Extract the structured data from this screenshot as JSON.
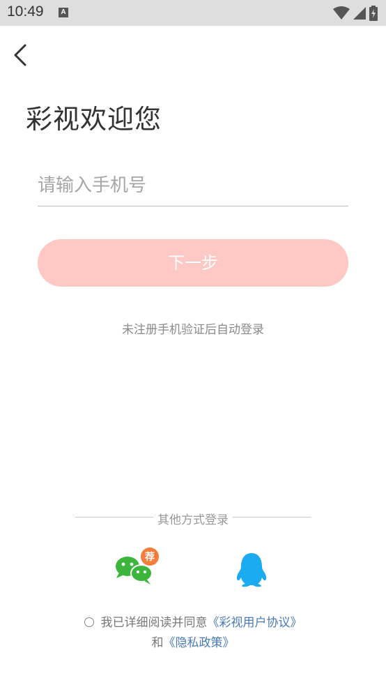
{
  "status_bar": {
    "time": "10:49",
    "notification_icon_label": "A"
  },
  "title": "彩视欢迎您",
  "phone_input": {
    "placeholder": "请输入手机号",
    "value": ""
  },
  "next_button_label": "下一步",
  "hint": "未注册手机验证后自动登录",
  "other_login_label": "其他方式登录",
  "wechat_badge": "荐",
  "agreement": {
    "prefix": "我已详细阅读并同意",
    "user_agreement_link": "《彩视用户协议》",
    "conjunction": "和",
    "privacy_link": "《隐私政策》"
  },
  "colors": {
    "status_bar": "#dedede",
    "next_button": "#fec8c4",
    "link": "#4a7bb7",
    "wechat_green": "#3cb53c",
    "qq_blue": "#1aabf1",
    "badge_orange": "#f47d3c"
  },
  "icons": [
    "back-arrow-icon",
    "wifi-icon",
    "signal-icon",
    "battery-icon",
    "wechat-icon",
    "qq-icon"
  ]
}
